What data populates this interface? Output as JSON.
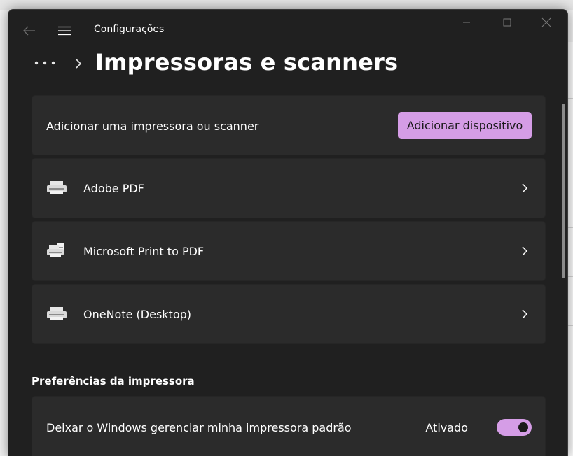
{
  "window": {
    "app_title": "Configurações"
  },
  "header": {
    "page_title": "Impressoras e scanners"
  },
  "add_card": {
    "label": "Adicionar uma impressora ou scanner",
    "button_label": "Adicionar dispositivo"
  },
  "printers": [
    {
      "name": "Adobe PDF",
      "icon": "printer-icon"
    },
    {
      "name": "Microsoft Print to PDF",
      "icon": "printer-paper-icon"
    },
    {
      "name": "OneNote (Desktop)",
      "icon": "printer-icon"
    }
  ],
  "preferences": {
    "section_title": "Preferências da impressora",
    "default_printer_label": "Deixar o Windows gerenciar minha impressora padrão",
    "toggle_state_label": "Ativado",
    "toggle_on": true
  },
  "colors": {
    "window_bg": "#202020",
    "card_bg": "#2b2b2b",
    "accent": "#d59de6",
    "text": "#ffffff"
  }
}
